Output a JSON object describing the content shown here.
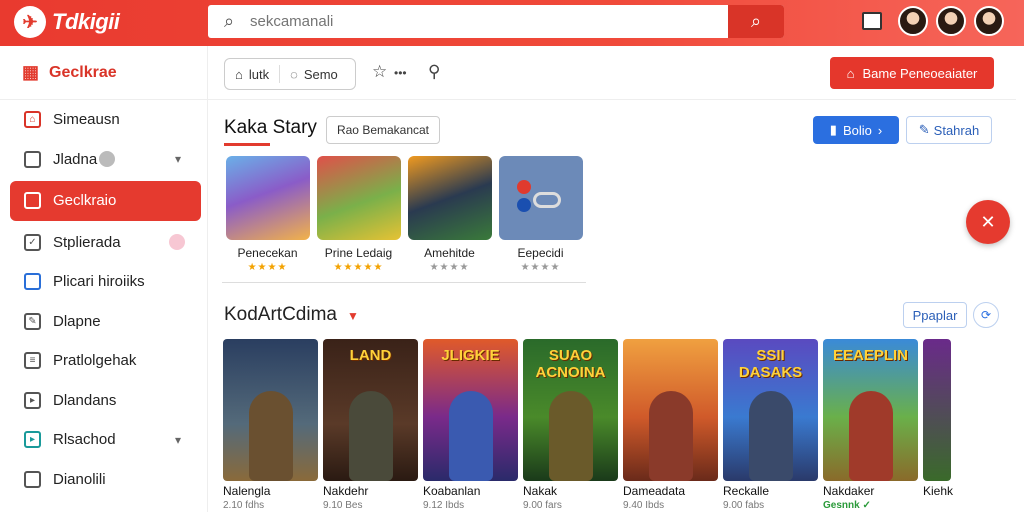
{
  "header": {
    "logo_text": "Tdkigii",
    "search_placeholder": "sekcamanali",
    "colors": {
      "accent": "#e93a2f",
      "primary_blue": "#2b6fe0"
    }
  },
  "sidebar": {
    "heading": "Geclkrae",
    "items": [
      {
        "label": "Simeausn",
        "icon": "home-icon"
      },
      {
        "label": "Jladna",
        "icon": "bookmark-icon"
      },
      {
        "label": "Geclkraio",
        "icon": "tag-icon",
        "active": true
      },
      {
        "label": "Stplierada",
        "icon": "checkbox-icon"
      },
      {
        "label": "Plicari hiroiiks",
        "icon": "grid-icon"
      },
      {
        "label": "Dlapne",
        "icon": "edit-icon"
      },
      {
        "label": "Pratlolgehak",
        "icon": "list-icon"
      },
      {
        "label": "Dlandans",
        "icon": "play-icon"
      },
      {
        "label": "Rlsachod",
        "icon": "folder-icon"
      },
      {
        "label": "Dianolili",
        "icon": "document-icon"
      }
    ]
  },
  "toolbar": {
    "pill_left": "lutk",
    "pill_right": "Semo",
    "primary_button": "Bame Peneoeaiater"
  },
  "section1": {
    "title": "Kaka Stary",
    "chip": "Rao Bemakancat",
    "btn_blue": "Bolio",
    "btn_outline": "Stahrah",
    "cards": [
      {
        "label": "Penecekan",
        "rating": "★★★★"
      },
      {
        "label": "Prine Ledaig",
        "rating": "★★★★★"
      },
      {
        "label": "Amehitde",
        "rating": "★★★★"
      },
      {
        "label": "Eepecidi",
        "rating": "★★★★"
      }
    ]
  },
  "section2": {
    "title": "KodArtCdima",
    "btn_popular": "Ppaplar",
    "cards": [
      {
        "label": "Nalengla",
        "meta": "2.10 fdhs",
        "poster_text": ""
      },
      {
        "label": "Nakdehr",
        "meta": "9.10 Bes",
        "poster_text": "LAND"
      },
      {
        "label": "Koabanlan",
        "meta": "9.12 Ibds",
        "poster_text": "JLIGKIE"
      },
      {
        "label": "Nakak",
        "meta": "9.00 fars",
        "poster_text": "SUAO ACNOINA"
      },
      {
        "label": "Dameadata",
        "meta": "9.40 Ibds",
        "poster_text": ""
      },
      {
        "label": "Reckalle",
        "meta": "9.00 fabs",
        "poster_text": "SSII DASAKS"
      },
      {
        "label": "Nakdaker",
        "meta": "Gesnnk ✓",
        "poster_text": "EEAEPLIN"
      },
      {
        "label": "Kiehk",
        "meta": "",
        "poster_text": ""
      }
    ]
  }
}
